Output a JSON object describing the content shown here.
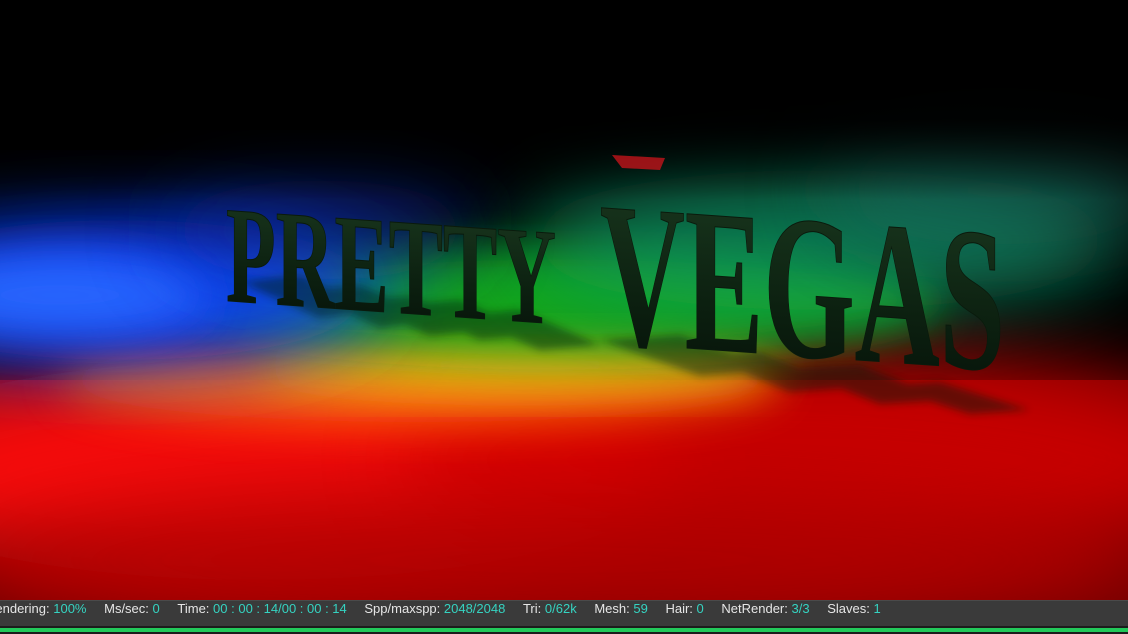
{
  "render": {
    "scene_text_left": "PRETTY",
    "scene_text_right": "VEGAS",
    "colors": {
      "blue": "#0a3cff",
      "green": "#19c21e",
      "red": "#e00808",
      "letters": "#0e2a14"
    }
  },
  "status": {
    "rendering_label": "Rendering:",
    "rendering_value": "100%",
    "mssec_label": "Ms/sec:",
    "mssec_value": "0",
    "time_label": "Time:",
    "time_value": "00 : 00 : 14/00 : 00 : 14",
    "spp_label": "Spp/maxspp:",
    "spp_value": "2048/2048",
    "tri_label": "Tri:",
    "tri_value": "0/62k",
    "mesh_label": "Mesh:",
    "mesh_value": "59",
    "hair_label": "Hair:",
    "hair_value": "0",
    "netrender_label": "NetRender:",
    "netrender_value": "3/3",
    "slaves_label": "Slaves:",
    "slaves_value": "1"
  },
  "progress": {
    "fraction": 1.0,
    "color": "#22c95a"
  }
}
